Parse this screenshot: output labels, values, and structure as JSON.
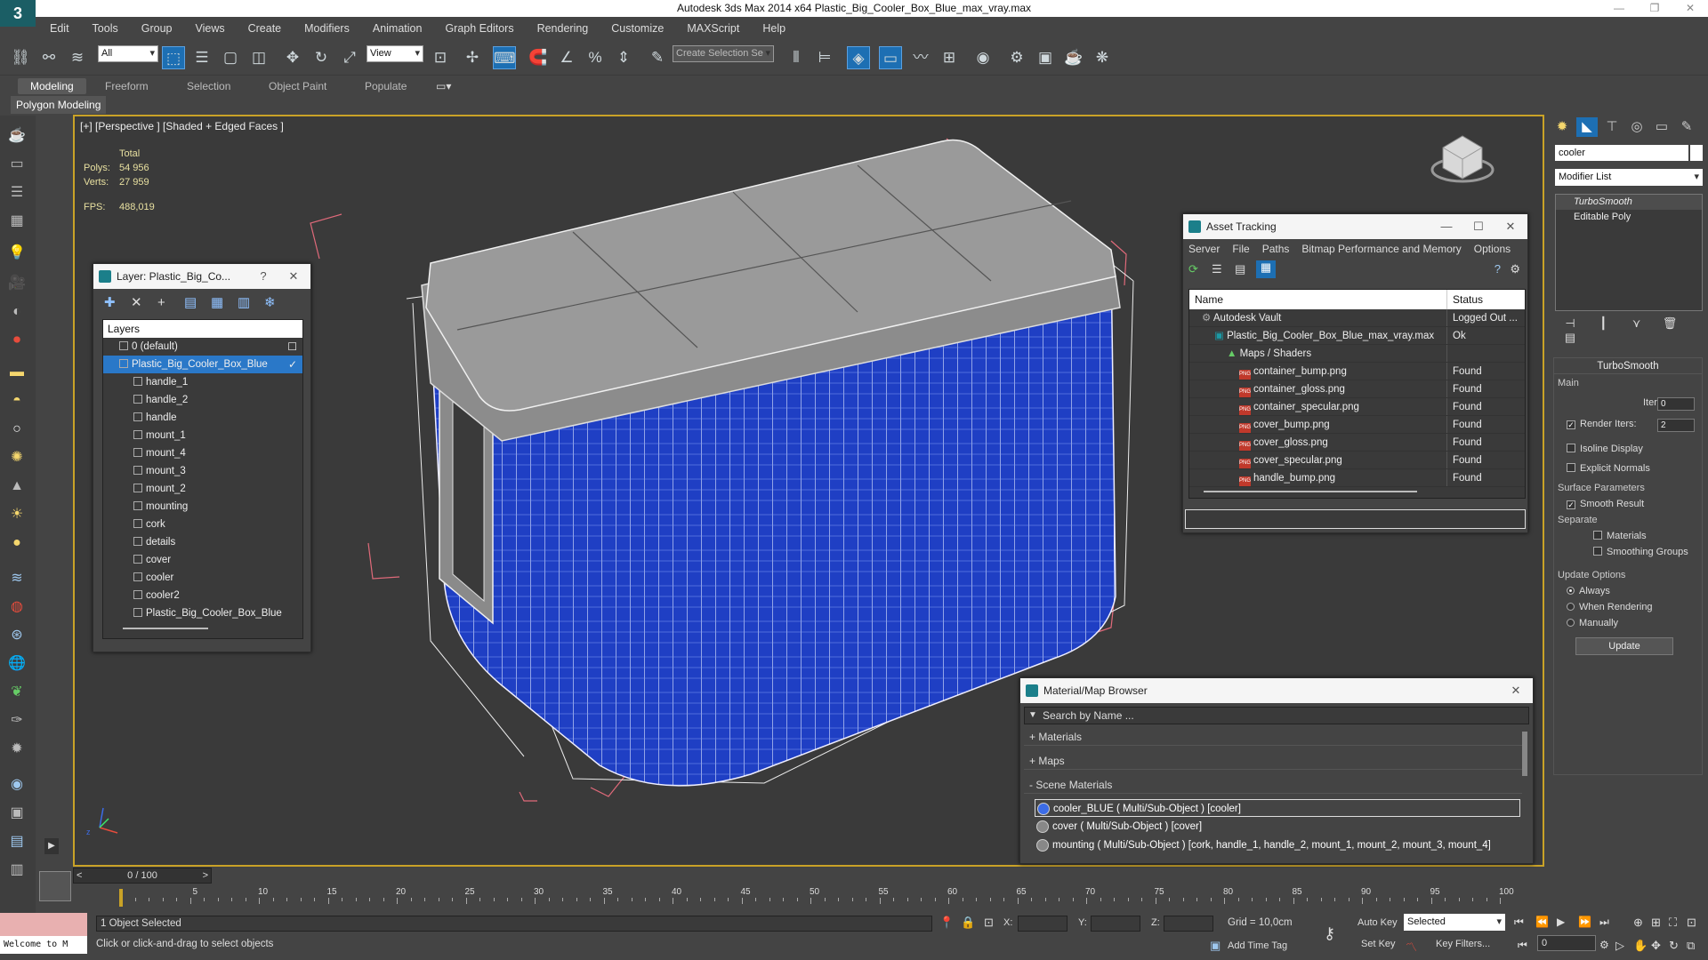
{
  "window": {
    "title": "Autodesk 3ds Max  2014 x64     Plastic_Big_Cooler_Box_Blue_max_vray.max",
    "logo_glyph": "3"
  },
  "menu": [
    "Edit",
    "Tools",
    "Group",
    "Views",
    "Create",
    "Modifiers",
    "Animation",
    "Graph Editors",
    "Rendering",
    "Customize",
    "MAXScript",
    "Help"
  ],
  "toolbar": {
    "selection_filter": "All",
    "ref_coord": "View",
    "named_selection_placeholder": "Create Selection Se"
  },
  "ribbon": {
    "tabs": [
      "Modeling",
      "Freeform",
      "Selection",
      "Object Paint",
      "Populate"
    ],
    "subtab": "Polygon Modeling"
  },
  "viewport": {
    "label": "[+] [Perspective ] [Shaded + Edged Faces ]",
    "stats": {
      "total_label": "Total",
      "polys_label": "Polys:",
      "polys": "54 956",
      "verts_label": "Verts:",
      "verts": "27 959",
      "fps_label": "FPS:",
      "fps": "488,019"
    },
    "axis_labels": {
      "x": "x",
      "y": "y",
      "z": "z"
    }
  },
  "layer_panel": {
    "title": "Layer: Plastic_Big_Co...",
    "help": "?",
    "close": "✕",
    "header": "Layers",
    "rows": [
      {
        "name": "0 (default)",
        "indent": 0
      },
      {
        "name": "Plastic_Big_Cooler_Box_Blue",
        "indent": 0,
        "selected": true
      },
      {
        "name": "handle_1",
        "indent": 1
      },
      {
        "name": "handle_2",
        "indent": 1
      },
      {
        "name": "handle",
        "indent": 1
      },
      {
        "name": "mount_1",
        "indent": 1
      },
      {
        "name": "mount_4",
        "indent": 1
      },
      {
        "name": "mount_3",
        "indent": 1
      },
      {
        "name": "mount_2",
        "indent": 1
      },
      {
        "name": "mounting",
        "indent": 1
      },
      {
        "name": "cork",
        "indent": 1
      },
      {
        "name": "details",
        "indent": 1
      },
      {
        "name": "cover",
        "indent": 1
      },
      {
        "name": "cooler",
        "indent": 1
      },
      {
        "name": "cooler2",
        "indent": 1
      },
      {
        "name": "Plastic_Big_Cooler_Box_Blue",
        "indent": 1
      }
    ]
  },
  "asset_panel": {
    "title": "Asset Tracking",
    "menu": [
      "Server",
      "File",
      "Paths",
      "Bitmap Performance and Memory",
      "Options"
    ],
    "col_name": "Name",
    "col_status": "Status",
    "rows": [
      {
        "name": "Autodesk Vault",
        "status": "Logged Out ...",
        "indent": 1,
        "icon": "vault"
      },
      {
        "name": "Plastic_Big_Cooler_Box_Blue_max_vray.max",
        "status": "Ok",
        "indent": 2,
        "icon": "max"
      },
      {
        "name": "Maps / Shaders",
        "status": "",
        "indent": 3,
        "icon": "maps"
      },
      {
        "name": "container_bump.png",
        "status": "Found",
        "indent": 4,
        "icon": "png"
      },
      {
        "name": "container_gloss.png",
        "status": "Found",
        "indent": 4,
        "icon": "png"
      },
      {
        "name": "container_specular.png",
        "status": "Found",
        "indent": 4,
        "icon": "png"
      },
      {
        "name": "cover_bump.png",
        "status": "Found",
        "indent": 4,
        "icon": "png"
      },
      {
        "name": "cover_gloss.png",
        "status": "Found",
        "indent": 4,
        "icon": "png"
      },
      {
        "name": "cover_specular.png",
        "status": "Found",
        "indent": 4,
        "icon": "png"
      },
      {
        "name": "handle_bump.png",
        "status": "Found",
        "indent": 4,
        "icon": "png"
      }
    ]
  },
  "material_panel": {
    "title": "Material/Map Browser",
    "search_placeholder": "Search by Name ...",
    "sections": [
      "+ Materials",
      "+ Maps",
      "- Scene Materials"
    ],
    "scene_materials": [
      "cooler_BLUE  ( Multi/Sub-Object )  [cooler]",
      "cover  ( Multi/Sub-Object )  [cover]",
      "mounting  ( Multi/Sub-Object )  [cork, handle_1, handle_2, mount_1, mount_2, mount_3, mount_4]"
    ]
  },
  "command_panel": {
    "object_name": "cooler",
    "modifier_list": "Modifier List",
    "stack": [
      "TurboSmooth",
      "Editable Poly"
    ],
    "rollout": {
      "title": "TurboSmooth",
      "main": "Main",
      "iterations_label": "Iterations:",
      "iterations": "0",
      "render_iters_label": "Render Iters:",
      "render_iters": "2",
      "isoline": "Isoline Display",
      "explicit_normals": "Explicit Normals",
      "surface_params": "Surface Parameters",
      "smooth_result": "Smooth Result",
      "separate": "Separate",
      "materials": "Materials",
      "smoothing_groups": "Smoothing Groups",
      "update_options": "Update Options",
      "always": "Always",
      "when_rendering": "When Rendering",
      "manually": "Manually",
      "update_btn": "Update"
    }
  },
  "bottom": {
    "time_slider": "0 / 100",
    "timeline_ticks": [
      "0",
      "5",
      "10",
      "15",
      "20",
      "25",
      "30",
      "35",
      "40",
      "45",
      "50",
      "55",
      "60",
      "65",
      "70",
      "75",
      "80",
      "85",
      "90",
      "95",
      "100"
    ],
    "maxscript": "Welcome to M",
    "status1": "1 Object Selected",
    "status2": "Click or click-and-drag to select objects",
    "x": "X:",
    "y": "Y:",
    "z": "Z:",
    "grid": "Grid = 10,0cm",
    "add_time_tag": "Add Time Tag",
    "auto_key": "Auto Key",
    "set_key": "Set Key",
    "key_mode": "Selected",
    "key_filters": "Key Filters...",
    "frame": "0"
  }
}
